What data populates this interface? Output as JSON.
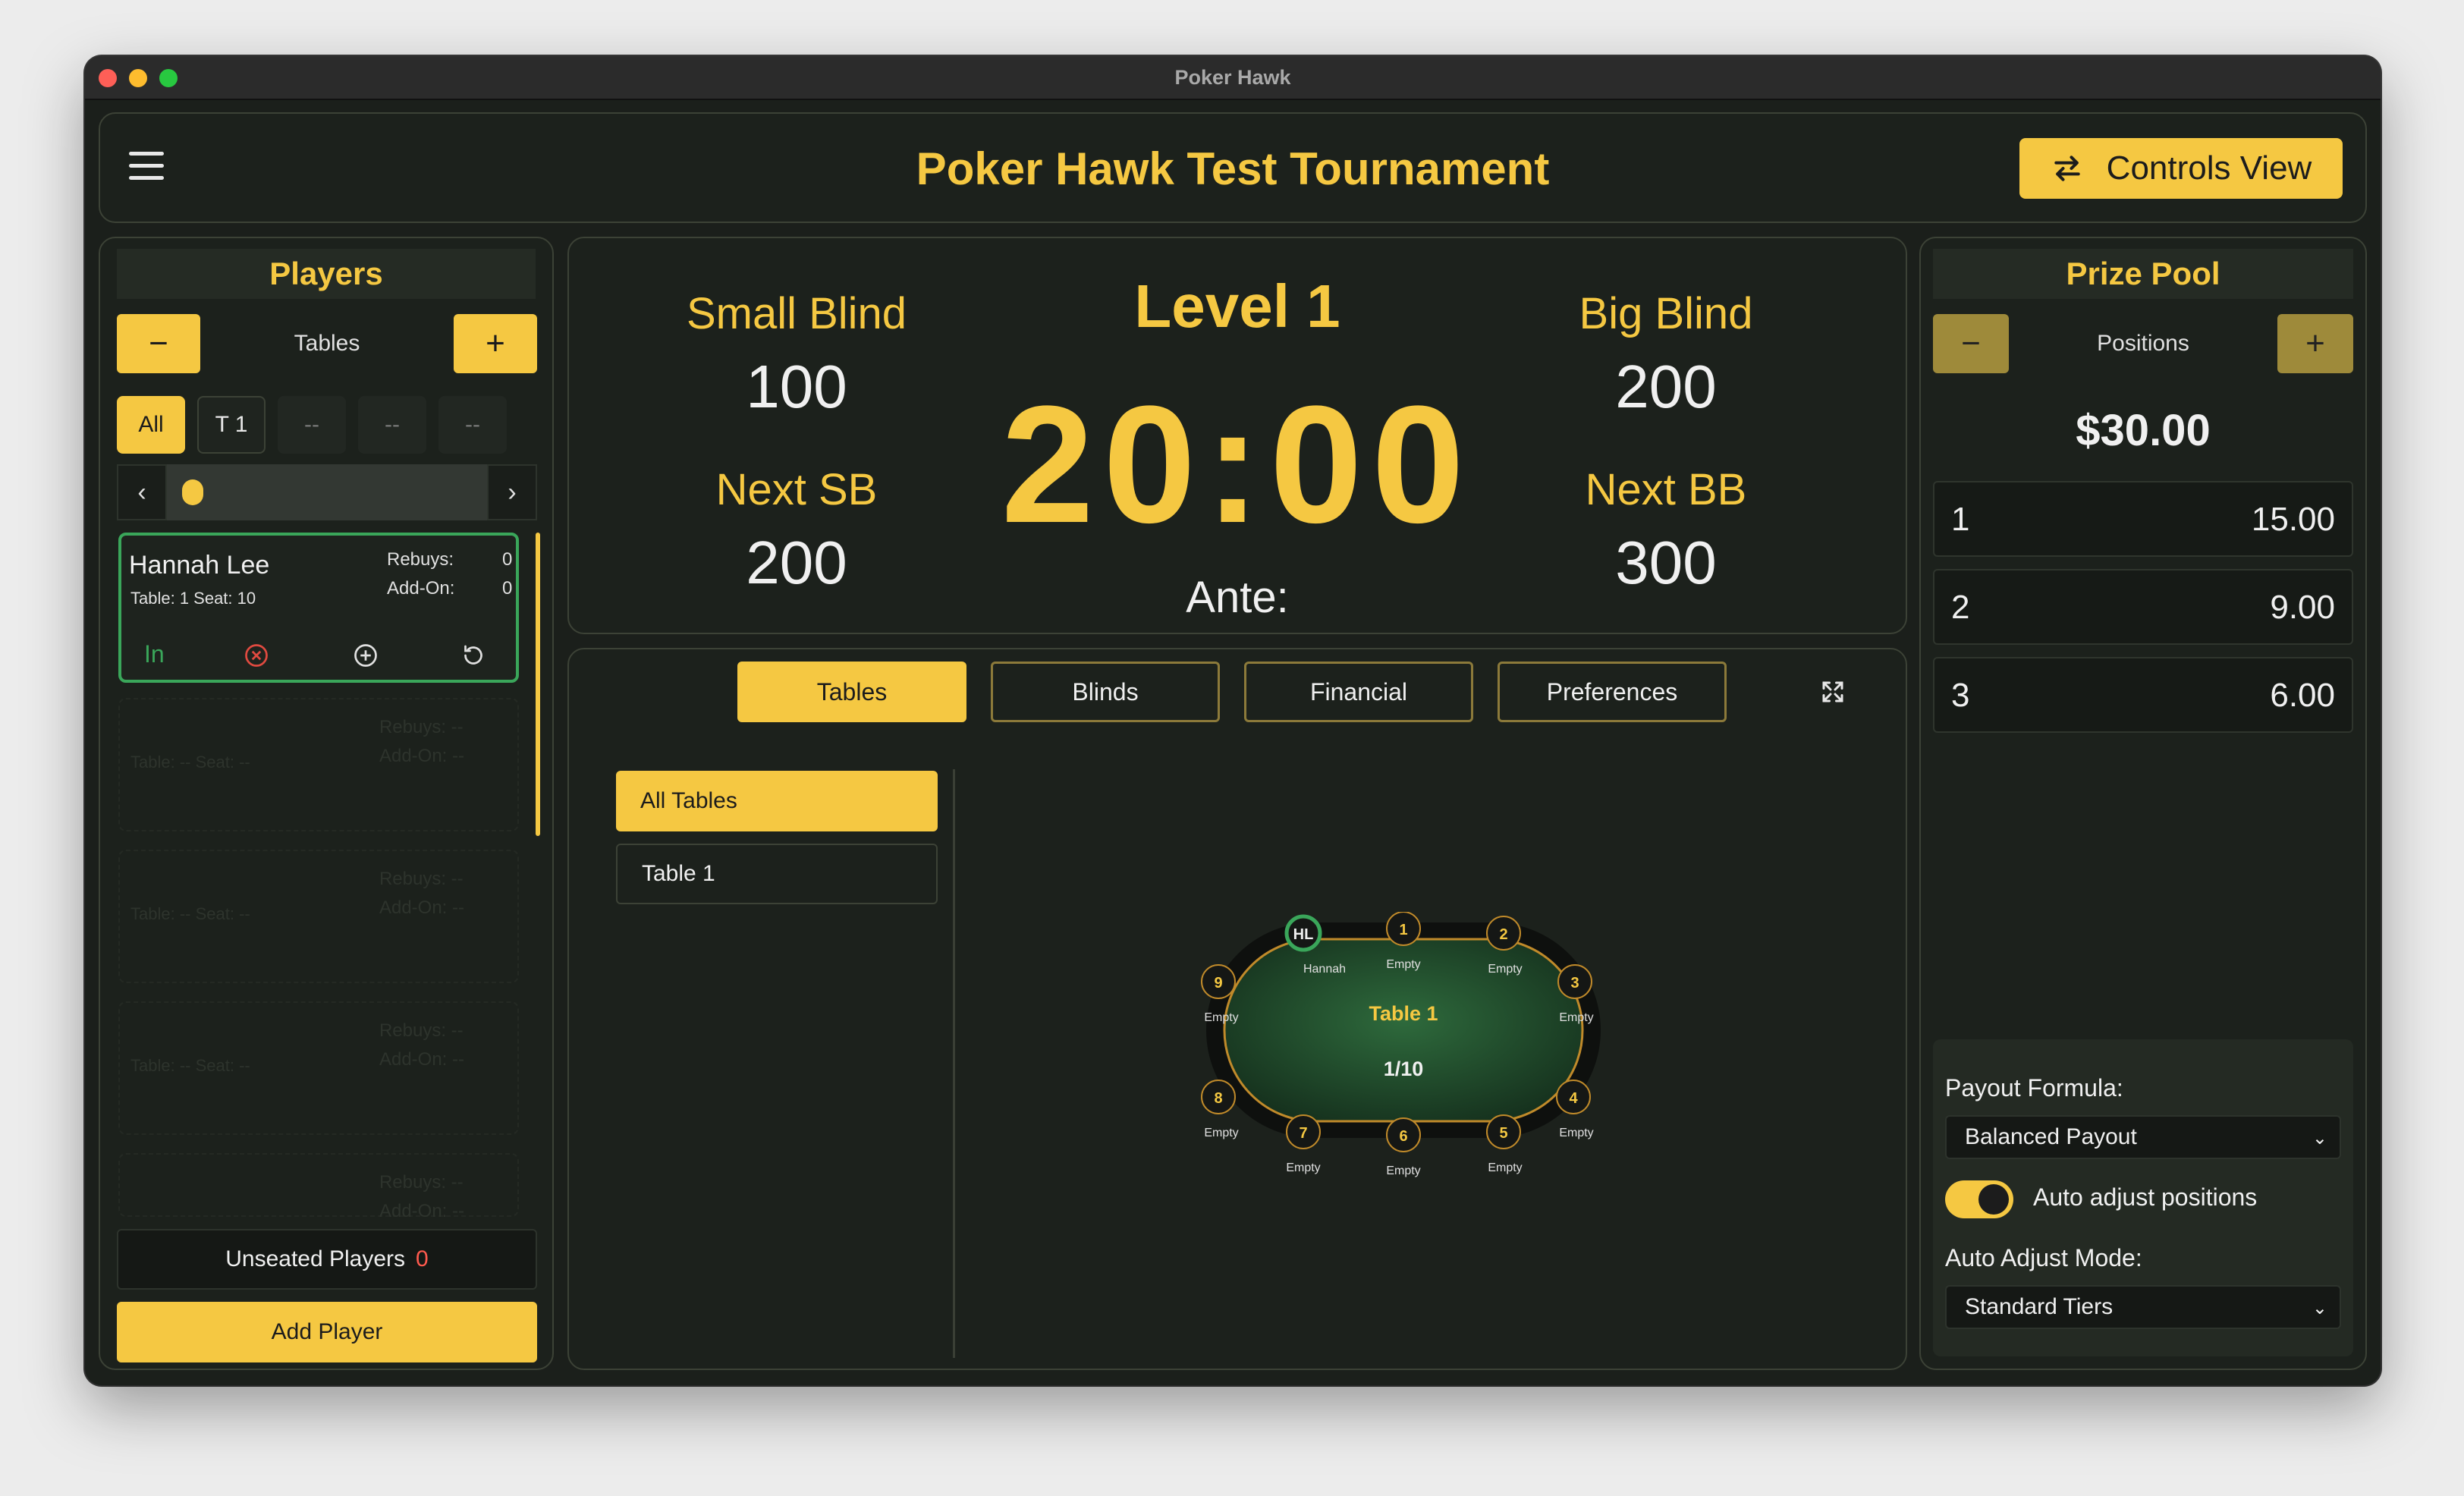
{
  "window_title": "Poker Hawk",
  "header": {
    "title": "Poker Hawk Test Tournament",
    "controls_label": "Controls View"
  },
  "players": {
    "title": "Players",
    "stepper_label": "Tables",
    "filters": [
      "All",
      "T 1",
      "--",
      "--",
      "--"
    ],
    "card": {
      "name": "Hannah Lee",
      "seat_text": "Table:  1 Seat:  10",
      "rebuys_label": "Rebuys:",
      "rebuys_value": "0",
      "addon_label": "Add-On:",
      "addon_value": "0",
      "status": "In"
    },
    "unseated_label": "Unseated Players",
    "unseated_count": "0",
    "add_player_label": "Add Player"
  },
  "clock": {
    "level": "Level 1",
    "time": "20:00",
    "small_blind_label": "Small Blind",
    "small_blind": "100",
    "big_blind_label": "Big Blind",
    "big_blind": "200",
    "next_sb_label": "Next SB",
    "next_sb": "200",
    "next_bb_label": "Next BB",
    "next_bb": "300",
    "ante_label": "Ante:"
  },
  "tabs": [
    "Tables",
    "Blinds",
    "Financial",
    "Preferences"
  ],
  "table_list": [
    "All Tables",
    "Table 1"
  ],
  "table_view": {
    "name": "Table 1",
    "count": "1/10",
    "seats": [
      {
        "id": "HL",
        "label": "Hannah"
      },
      {
        "id": "1",
        "label": "Empty"
      },
      {
        "id": "2",
        "label": "Empty"
      },
      {
        "id": "3",
        "label": "Empty"
      },
      {
        "id": "4",
        "label": "Empty"
      },
      {
        "id": "5",
        "label": "Empty"
      },
      {
        "id": "6",
        "label": "Empty"
      },
      {
        "id": "7",
        "label": "Empty"
      },
      {
        "id": "8",
        "label": "Empty"
      },
      {
        "id": "9",
        "label": "Empty"
      }
    ]
  },
  "prize": {
    "title": "Prize Pool",
    "stepper_label": "Positions",
    "total": "$30.00",
    "payouts": [
      {
        "position": "1",
        "amount": "15.00"
      },
      {
        "position": "2",
        "amount": "9.00"
      },
      {
        "position": "3",
        "amount": "6.00"
      }
    ],
    "formula_label": "Payout Formula:",
    "formula_value": "Balanced Payout",
    "auto_adjust_label": "Auto adjust positions",
    "mode_label": "Auto Adjust Mode:",
    "mode_value": "Standard Tiers"
  },
  "colors": {
    "accent": "#f5c842",
    "background": "#1b1f1b",
    "active_border": "#3aa65a",
    "danger": "#ff5a4e"
  }
}
